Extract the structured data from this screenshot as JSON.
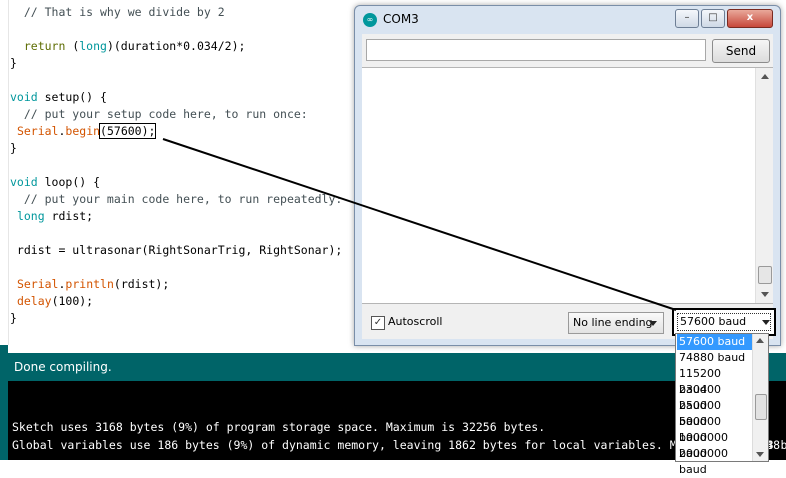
{
  "editor": {
    "lines": [
      "  // That is why we divide by 2",
      "",
      "  return (long)(duration*0.034/2);",
      "}",
      "",
      "void setup() {",
      "  // put your setup code here, to run once:",
      " Serial.begin(57600);",
      "}",
      "",
      "void loop() {",
      "  // put your main code here, to run repeatedly:",
      " long rdist;",
      "",
      " rdist = ultrasonar(RightSonarTrig, RightSonar);",
      "",
      " Serial.println(rdist);",
      " delay(100);",
      "}"
    ],
    "highlighted_baud": "57600"
  },
  "status": {
    "message": "Done compiling."
  },
  "console": {
    "lines": [
      "Sketch uses 3168 bytes (9%) of program storage space. Maximum is 32256 bytes.",
      "Global variables use 186 bytes (9%) of dynamic memory, leaving 1862 bytes for local variables. Maximum is 2048 bytes."
    ],
    "tail_fragment": "48"
  },
  "serial_monitor": {
    "title": "COM3",
    "app_icon_glyph": "∞",
    "send_label": "Send",
    "input_value": "",
    "autoscroll_label": "Autoscroll",
    "autoscroll_checked": "✓",
    "line_ending": "No line ending",
    "baud_rate": "57600 baud",
    "window_buttons": {
      "minimize": "–",
      "maximize": "□",
      "close": "x"
    }
  },
  "baud_options": [
    "57600 baud",
    "74880 baud",
    "115200 baud",
    "230400 baud",
    "250000 baud",
    "500000 baud",
    "1000000 baud",
    "2000000 baud"
  ],
  "colors": {
    "accent": "#006468",
    "selection": "#3399ff",
    "console_bg": "#000000"
  }
}
